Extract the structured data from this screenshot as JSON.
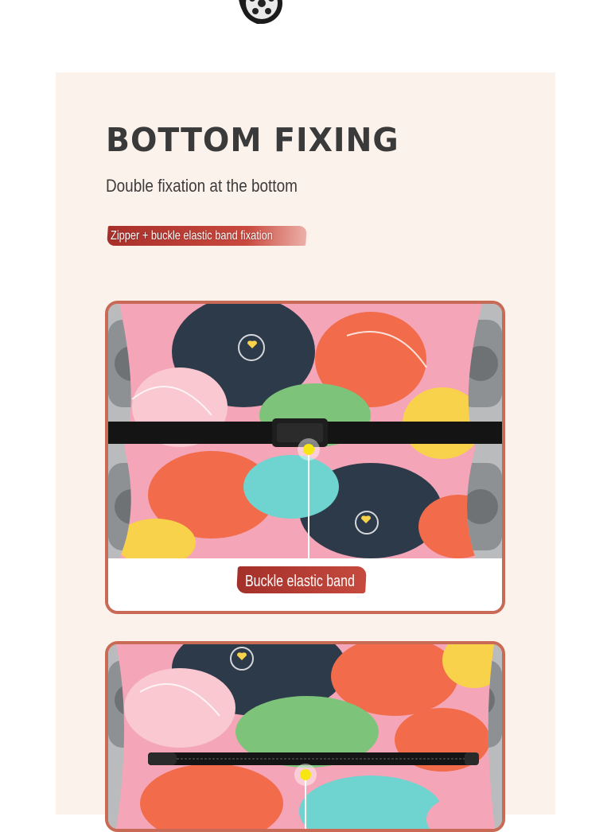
{
  "section": {
    "title": "BOTTOM FIXING",
    "subtitle": "Double fixation at the bottom",
    "ribbon_label": "Zipper + buckle elastic band fixation"
  },
  "photos": [
    {
      "caption": "Buckle elastic band",
      "detail": "buckle-strap"
    },
    {
      "detail": "zipper"
    }
  ],
  "colors": {
    "panel_bg": "#fcf2ec",
    "accent": "#c86a55",
    "ribbon": "#b33a31",
    "heading": "#3a3a3a",
    "highlight_dot": "#f5e614"
  }
}
